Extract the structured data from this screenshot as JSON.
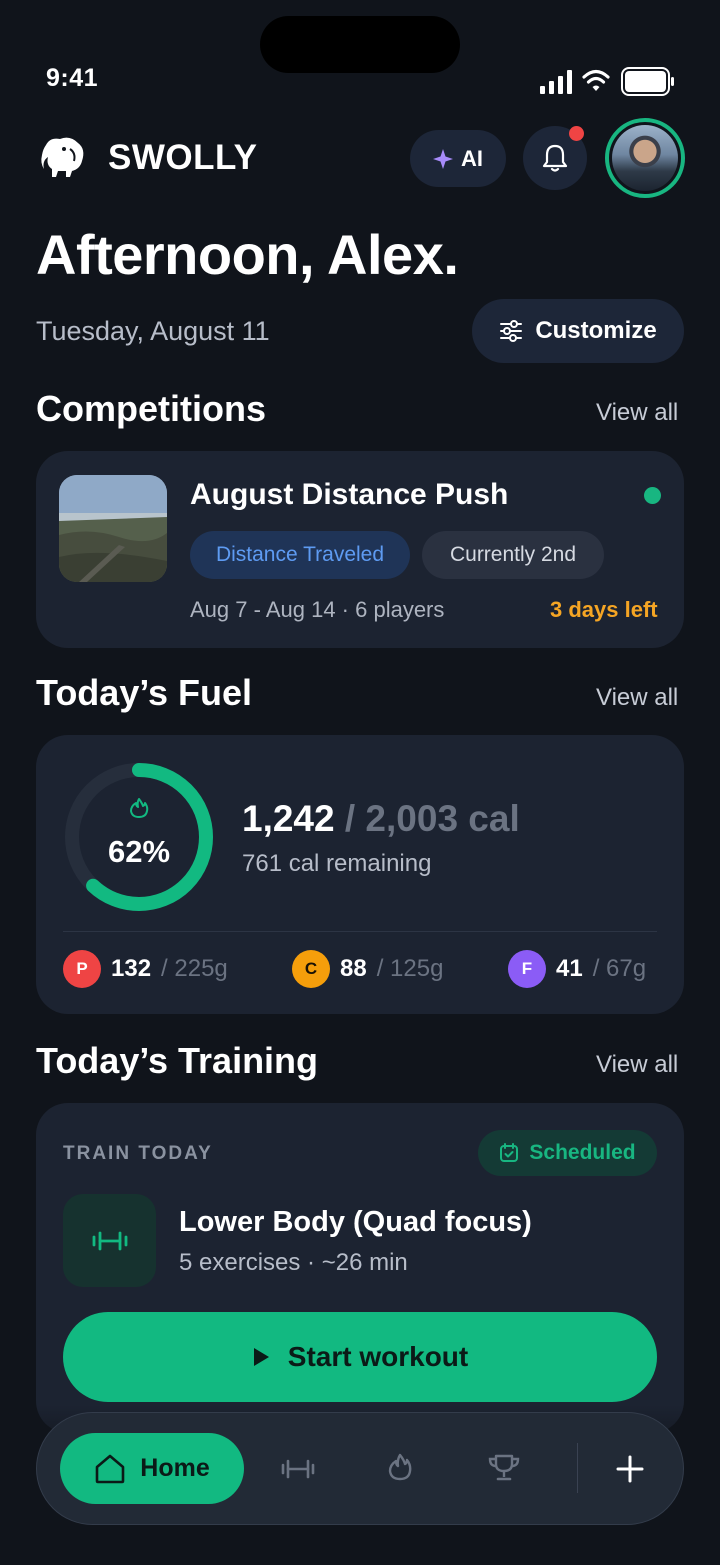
{
  "status_bar": {
    "time": "9:41"
  },
  "header": {
    "brand": "SWOLLY",
    "ai_label": "AI",
    "has_notification": true
  },
  "greeting": {
    "title": "Afternoon, Alex.",
    "date": "Tuesday, August 11",
    "customize_label": "Customize"
  },
  "competitions": {
    "section_title": "Competitions",
    "view_all": "View all",
    "item": {
      "title": "August Distance Push",
      "metric_tag": "Distance Traveled",
      "rank_tag": "Currently 2nd",
      "meta": "Aug 7 - Aug 14 · 6 players",
      "days_left": "3 days left",
      "status_color": "#18b681"
    }
  },
  "fuel": {
    "section_title": "Today’s Fuel",
    "view_all": "View all",
    "percent_label": "62%",
    "progress": 0.62,
    "consumed": "1,242",
    "goal": "/ 2,003 cal",
    "remaining": "761 cal remaining",
    "macros": [
      {
        "letter": "P",
        "value": "132",
        "goal": "/ 225g",
        "color": "#ef4444"
      },
      {
        "letter": "C",
        "value": "88",
        "goal": "/ 125g",
        "color": "#f59e0b"
      },
      {
        "letter": "F",
        "value": "41",
        "goal": "/ 67g",
        "color": "#8b5cf6"
      }
    ]
  },
  "training": {
    "section_title": "Today’s Training",
    "view_all": "View all",
    "label": "TRAIN TODAY",
    "status": "Scheduled",
    "workout_title": "Lower Body (Quad focus)",
    "workout_meta": "5 exercises · ~26 min",
    "start_label": "Start workout"
  },
  "nav": {
    "home_label": "Home",
    "items": [
      "home-icon",
      "dumbbell-icon",
      "flame-icon",
      "trophy-icon",
      "plus-icon"
    ]
  },
  "colors": {
    "accent": "#12b981",
    "background": "#10141b",
    "card": "#1c2331"
  }
}
